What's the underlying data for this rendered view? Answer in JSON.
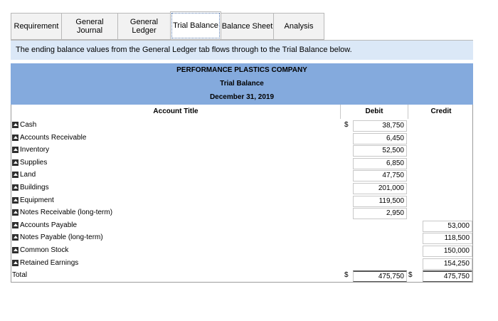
{
  "tabs": [
    {
      "label": "Requirement"
    },
    {
      "label": "General\nJournal"
    },
    {
      "label": "General\nLedger"
    },
    {
      "label": "Trial Balance"
    },
    {
      "label": "Balance Sheet"
    },
    {
      "label": "Analysis"
    }
  ],
  "info_text": "The ending balance values from the General Ledger tab flows through to the Trial Balance below.",
  "heading": {
    "company": "PERFORMANCE PLASTICS COMPANY",
    "report": "Trial Balance",
    "date": "December 31, 2019"
  },
  "columns": {
    "title": "Account Title",
    "debit": "Debit",
    "credit": "Credit"
  },
  "dollar_sign": "$",
  "rows": [
    {
      "account": "Cash",
      "debit": "38,750",
      "credit": ""
    },
    {
      "account": "Accounts Receivable",
      "debit": "6,450",
      "credit": ""
    },
    {
      "account": "Inventory",
      "debit": "52,500",
      "credit": ""
    },
    {
      "account": "Supplies",
      "debit": "6,850",
      "credit": ""
    },
    {
      "account": "Land",
      "debit": "47,750",
      "credit": ""
    },
    {
      "account": "Buildings",
      "debit": "201,000",
      "credit": ""
    },
    {
      "account": "Equipment",
      "debit": "119,500",
      "credit": ""
    },
    {
      "account": "Notes Receivable (long-term)",
      "debit": "2,950",
      "credit": ""
    },
    {
      "account": "Accounts Payable",
      "debit": "",
      "credit": "53,000"
    },
    {
      "account": "Notes Payable (long-term)",
      "debit": "",
      "credit": "118,500"
    },
    {
      "account": "Common Stock",
      "debit": "",
      "credit": "150,000"
    },
    {
      "account": "Retained Earnings",
      "debit": "",
      "credit": "154,250"
    }
  ],
  "total": {
    "label": "Total",
    "debit": "475,750",
    "credit": "475,750"
  }
}
